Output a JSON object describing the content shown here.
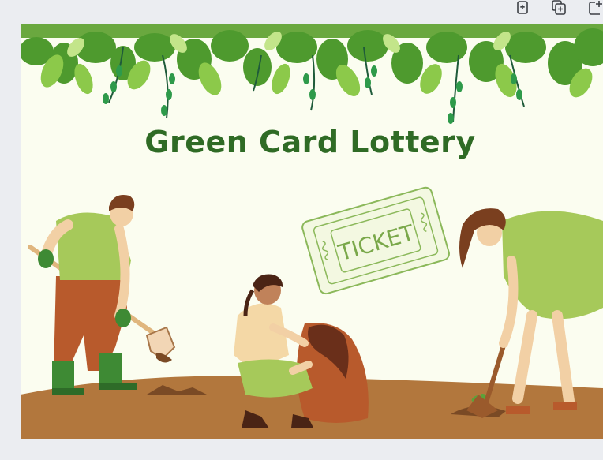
{
  "toolbar": {
    "buttons": [
      {
        "name": "lock-icon",
        "label": "Lock"
      },
      {
        "name": "duplicate-page-icon",
        "label": "Duplicate page"
      },
      {
        "name": "add-page-icon",
        "label": "Add page"
      }
    ]
  },
  "design": {
    "title": "Green Card Lottery",
    "ticket_text": "TICKET"
  },
  "colors": {
    "background": "#ebedf1",
    "canvas": "#fbfdf0",
    "title": "#2f6b25",
    "soil": "#b2773d",
    "leaf": "#5aa33a"
  }
}
